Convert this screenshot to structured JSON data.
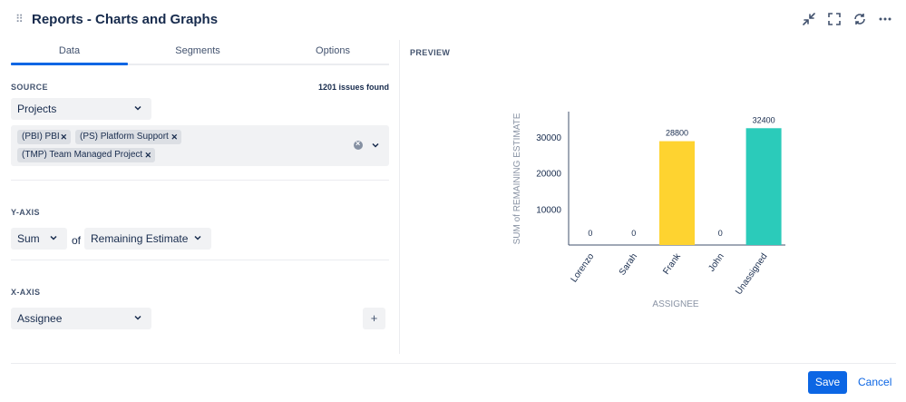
{
  "header": {
    "title": "Reports - Charts and Graphs",
    "icons": [
      "collapse-icon",
      "fullscreen-icon",
      "refresh-icon",
      "more-icon"
    ]
  },
  "tabs": [
    {
      "label": "Data",
      "active": true
    },
    {
      "label": "Segments",
      "active": false
    },
    {
      "label": "Options",
      "active": false
    }
  ],
  "source": {
    "label": "SOURCE",
    "issues_found": "1201 issues found",
    "type_value": "Projects",
    "projects": [
      "(PBI) PBI",
      "(PS) Platform Support",
      "(TMP) Team Managed Project"
    ]
  },
  "y_axis": {
    "label": "Y-AXIS",
    "aggregate": "Sum",
    "of_text": "of",
    "field": "Remaining Estimate"
  },
  "x_axis": {
    "label": "X-AXIS",
    "field": "Assignee",
    "add_label": "+"
  },
  "preview": {
    "label": "PREVIEW"
  },
  "chart_data": {
    "type": "bar",
    "categories": [
      "Lorenzo",
      "Sarah",
      "Frank",
      "John",
      "Unassigned"
    ],
    "values": [
      0,
      0,
      28800,
      0,
      32400
    ],
    "colors": [
      "#fed330",
      "#fed330",
      "#fed330",
      "#2bcbba",
      "#2bcbba"
    ],
    "xlabel": "ASSIGNEE",
    "ylabel": "SUM of REMAINING ESTIMATE",
    "yticks": [
      10000,
      20000,
      30000
    ],
    "ylim": [
      0,
      37000
    ]
  },
  "footer": {
    "save_label": "Save",
    "cancel_label": "Cancel"
  }
}
